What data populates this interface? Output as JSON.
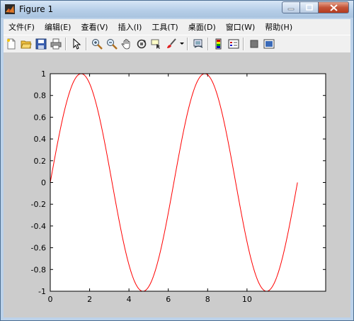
{
  "window": {
    "title": "Figure 1",
    "controls": {
      "minimize": "minimize",
      "maximize": "maximize",
      "close": "close"
    }
  },
  "menu": [
    {
      "label": "文件(F)"
    },
    {
      "label": "编辑(E)"
    },
    {
      "label": "查看(V)"
    },
    {
      "label": "插入(I)"
    },
    {
      "label": "工具(T)"
    },
    {
      "label": "桌面(D)"
    },
    {
      "label": "窗口(W)"
    },
    {
      "label": "帮助(H)"
    }
  ],
  "toolbar": [
    "new-figure-icon",
    "open-file-icon",
    "save-icon",
    "print-icon",
    "edit-plot-arrow-icon",
    "zoom-in-icon",
    "zoom-out-icon",
    "pan-hand-icon",
    "rotate-3d-icon",
    "data-cursor-icon",
    "brush-icon",
    "brush-dropdown-icon",
    "link-plot-icon",
    "colorbar-icon",
    "legend-icon",
    "hide-plot-tools-icon",
    "show-plot-tools-icon"
  ],
  "colors": {
    "line": "#ff0000",
    "figure_bg": "#cccccc",
    "axes_bg": "#ffffff"
  },
  "chart_data": {
    "type": "line",
    "function": "sin(x)",
    "xlim": [
      0,
      14
    ],
    "ylim": [
      -1,
      1
    ],
    "x_ticks": [
      0,
      2,
      4,
      6,
      8,
      10
    ],
    "y_ticks": [
      -1,
      -0.8,
      -0.6,
      -0.4,
      -0.2,
      0,
      0.2,
      0.4,
      0.6,
      0.8,
      1
    ],
    "x_range": [
      0,
      12.5664
    ],
    "series": [
      {
        "color": "#ff0000"
      }
    ],
    "grid": false
  }
}
